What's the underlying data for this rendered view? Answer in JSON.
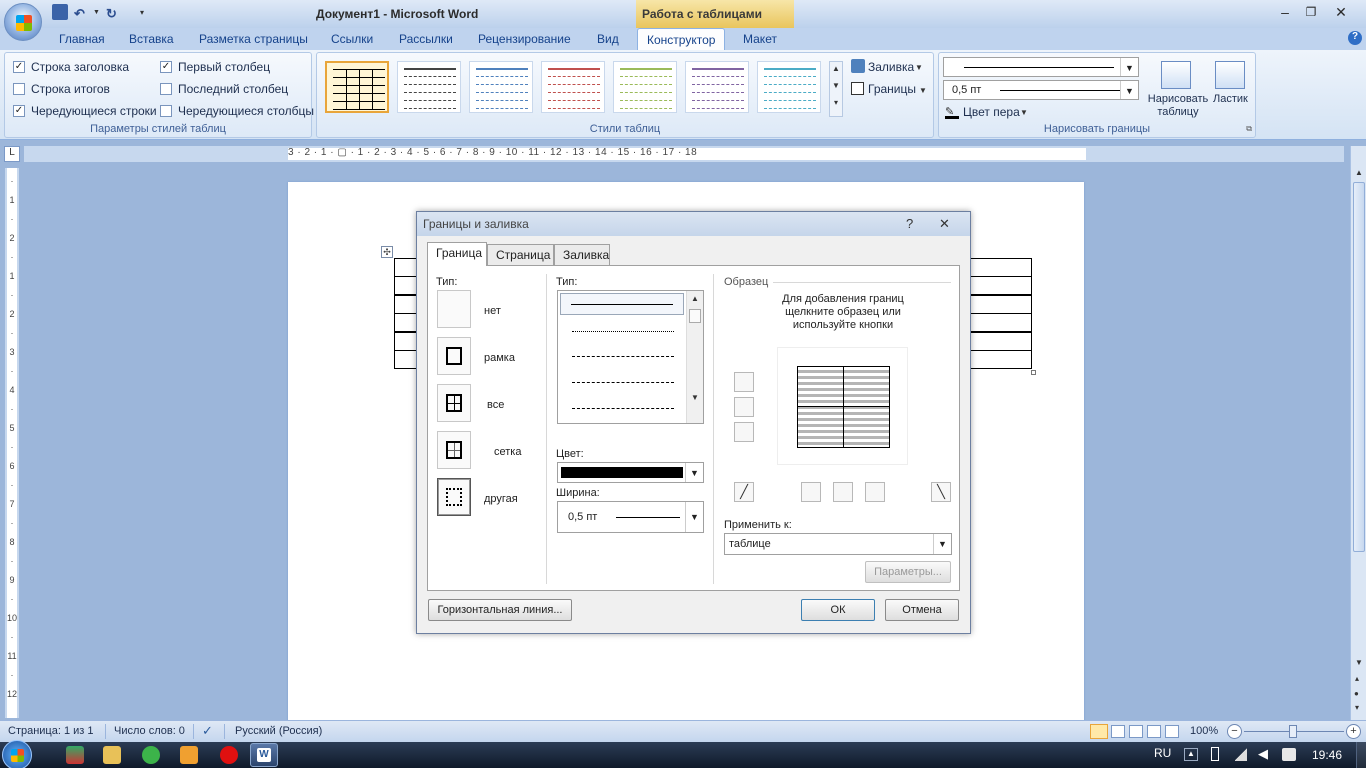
{
  "window": {
    "title": "Документ1 - Microsoft Word",
    "context_tab": "Работа с таблицами"
  },
  "ribbon_tabs": [
    "Главная",
    "Вставка",
    "Разметка страницы",
    "Ссылки",
    "Рассылки",
    "Рецензирование",
    "Вид",
    "Конструктор",
    "Макет"
  ],
  "active_tab": "Конструктор",
  "style_options": {
    "header_row": {
      "label": "Строка заголовка",
      "checked": true
    },
    "total_row": {
      "label": "Строка итогов",
      "checked": false
    },
    "banded_rows": {
      "label": "Чередующиеся строки",
      "checked": true
    },
    "first_column": {
      "label": "Первый столбец",
      "checked": true
    },
    "last_column": {
      "label": "Последний столбец",
      "checked": false
    },
    "banded_columns": {
      "label": "Чередующиеся столбцы",
      "checked": false
    },
    "group_label": "Параметры стилей таблиц"
  },
  "table_styles": {
    "group_label": "Стили таблиц",
    "shading_label": "Заливка",
    "borders_label": "Границы",
    "thumb_colors": [
      "#000000",
      "#444444",
      "#4f81bd",
      "#c0504d",
      "#9bbb59",
      "#8064a2",
      "#4bacc6"
    ]
  },
  "draw_borders": {
    "line_width": "0,5 пт",
    "pen_color_label": "Цвет пера",
    "draw_table_label": "Нарисовать таблицу",
    "eraser_label": "Ластик",
    "group_label": "Нарисовать границы"
  },
  "ruler": {
    "horizontal": "3 · 2 · 1 · ▢ · 1 · 2 · 3 · 4 · 5 · 6 · 7 · 8 · 9 · 10 · 11 · 12 · 13 · 14 · 15 · 16 · 17 · 18",
    "vertical": "· 1 · 2 · 1 · 2 · 3 · 4 · 5 · 6 · 7 · 8 · 9 · 10 · 11 · 12",
    "tab_marker": "L"
  },
  "dialog": {
    "title": "Границы и заливка",
    "help": "?",
    "close": "✕",
    "tabs": [
      "Граница",
      "Страница",
      "Заливка"
    ],
    "active_tab": "Граница",
    "setting_label": "Тип:",
    "settings": [
      "нет",
      "рамка",
      "все",
      "сетка",
      "другая"
    ],
    "style_label": "Тип:",
    "color_label": "Цвет:",
    "width_label": "Ширина:",
    "width_value": "0,5 пт",
    "preview_label": "Образец",
    "preview_hint": "Для добавления границ щелкните образец или используйте кнопки",
    "apply_label": "Применить к:",
    "apply_value": "таблице",
    "options_button": "Параметры...",
    "horizontal_line_button": "Горизонтальная линия...",
    "ok_button": "ОК",
    "cancel_button": "Отмена"
  },
  "status_bar": {
    "page": "Страница: 1 из 1",
    "words": "Число слов: 0",
    "language": "Русский (Россия)",
    "zoom": "100%"
  },
  "taskbar": {
    "language": "RU",
    "time": "19:46"
  }
}
